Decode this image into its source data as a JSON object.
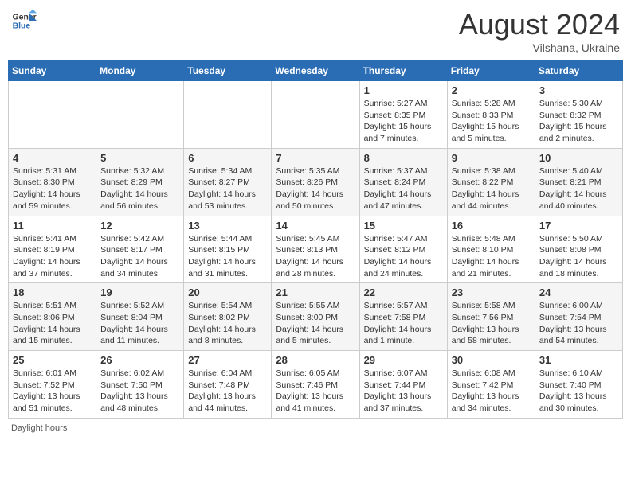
{
  "header": {
    "logo_general": "General",
    "logo_blue": "Blue",
    "month_title": "August 2024",
    "location": "Vilshana, Ukraine"
  },
  "days_of_week": [
    "Sunday",
    "Monday",
    "Tuesday",
    "Wednesday",
    "Thursday",
    "Friday",
    "Saturday"
  ],
  "footer_note": "Daylight hours",
  "weeks": [
    [
      {
        "day": "",
        "info": ""
      },
      {
        "day": "",
        "info": ""
      },
      {
        "day": "",
        "info": ""
      },
      {
        "day": "",
        "info": ""
      },
      {
        "day": "1",
        "info": "Sunrise: 5:27 AM\nSunset: 8:35 PM\nDaylight: 15 hours\nand 7 minutes."
      },
      {
        "day": "2",
        "info": "Sunrise: 5:28 AM\nSunset: 8:33 PM\nDaylight: 15 hours\nand 5 minutes."
      },
      {
        "day": "3",
        "info": "Sunrise: 5:30 AM\nSunset: 8:32 PM\nDaylight: 15 hours\nand 2 minutes."
      }
    ],
    [
      {
        "day": "4",
        "info": "Sunrise: 5:31 AM\nSunset: 8:30 PM\nDaylight: 14 hours\nand 59 minutes."
      },
      {
        "day": "5",
        "info": "Sunrise: 5:32 AM\nSunset: 8:29 PM\nDaylight: 14 hours\nand 56 minutes."
      },
      {
        "day": "6",
        "info": "Sunrise: 5:34 AM\nSunset: 8:27 PM\nDaylight: 14 hours\nand 53 minutes."
      },
      {
        "day": "7",
        "info": "Sunrise: 5:35 AM\nSunset: 8:26 PM\nDaylight: 14 hours\nand 50 minutes."
      },
      {
        "day": "8",
        "info": "Sunrise: 5:37 AM\nSunset: 8:24 PM\nDaylight: 14 hours\nand 47 minutes."
      },
      {
        "day": "9",
        "info": "Sunrise: 5:38 AM\nSunset: 8:22 PM\nDaylight: 14 hours\nand 44 minutes."
      },
      {
        "day": "10",
        "info": "Sunrise: 5:40 AM\nSunset: 8:21 PM\nDaylight: 14 hours\nand 40 minutes."
      }
    ],
    [
      {
        "day": "11",
        "info": "Sunrise: 5:41 AM\nSunset: 8:19 PM\nDaylight: 14 hours\nand 37 minutes."
      },
      {
        "day": "12",
        "info": "Sunrise: 5:42 AM\nSunset: 8:17 PM\nDaylight: 14 hours\nand 34 minutes."
      },
      {
        "day": "13",
        "info": "Sunrise: 5:44 AM\nSunset: 8:15 PM\nDaylight: 14 hours\nand 31 minutes."
      },
      {
        "day": "14",
        "info": "Sunrise: 5:45 AM\nSunset: 8:13 PM\nDaylight: 14 hours\nand 28 minutes."
      },
      {
        "day": "15",
        "info": "Sunrise: 5:47 AM\nSunset: 8:12 PM\nDaylight: 14 hours\nand 24 minutes."
      },
      {
        "day": "16",
        "info": "Sunrise: 5:48 AM\nSunset: 8:10 PM\nDaylight: 14 hours\nand 21 minutes."
      },
      {
        "day": "17",
        "info": "Sunrise: 5:50 AM\nSunset: 8:08 PM\nDaylight: 14 hours\nand 18 minutes."
      }
    ],
    [
      {
        "day": "18",
        "info": "Sunrise: 5:51 AM\nSunset: 8:06 PM\nDaylight: 14 hours\nand 15 minutes."
      },
      {
        "day": "19",
        "info": "Sunrise: 5:52 AM\nSunset: 8:04 PM\nDaylight: 14 hours\nand 11 minutes."
      },
      {
        "day": "20",
        "info": "Sunrise: 5:54 AM\nSunset: 8:02 PM\nDaylight: 14 hours\nand 8 minutes."
      },
      {
        "day": "21",
        "info": "Sunrise: 5:55 AM\nSunset: 8:00 PM\nDaylight: 14 hours\nand 5 minutes."
      },
      {
        "day": "22",
        "info": "Sunrise: 5:57 AM\nSunset: 7:58 PM\nDaylight: 14 hours\nand 1 minute."
      },
      {
        "day": "23",
        "info": "Sunrise: 5:58 AM\nSunset: 7:56 PM\nDaylight: 13 hours\nand 58 minutes."
      },
      {
        "day": "24",
        "info": "Sunrise: 6:00 AM\nSunset: 7:54 PM\nDaylight: 13 hours\nand 54 minutes."
      }
    ],
    [
      {
        "day": "25",
        "info": "Sunrise: 6:01 AM\nSunset: 7:52 PM\nDaylight: 13 hours\nand 51 minutes."
      },
      {
        "day": "26",
        "info": "Sunrise: 6:02 AM\nSunset: 7:50 PM\nDaylight: 13 hours\nand 48 minutes."
      },
      {
        "day": "27",
        "info": "Sunrise: 6:04 AM\nSunset: 7:48 PM\nDaylight: 13 hours\nand 44 minutes."
      },
      {
        "day": "28",
        "info": "Sunrise: 6:05 AM\nSunset: 7:46 PM\nDaylight: 13 hours\nand 41 minutes."
      },
      {
        "day": "29",
        "info": "Sunrise: 6:07 AM\nSunset: 7:44 PM\nDaylight: 13 hours\nand 37 minutes."
      },
      {
        "day": "30",
        "info": "Sunrise: 6:08 AM\nSunset: 7:42 PM\nDaylight: 13 hours\nand 34 minutes."
      },
      {
        "day": "31",
        "info": "Sunrise: 6:10 AM\nSunset: 7:40 PM\nDaylight: 13 hours\nand 30 minutes."
      }
    ]
  ]
}
